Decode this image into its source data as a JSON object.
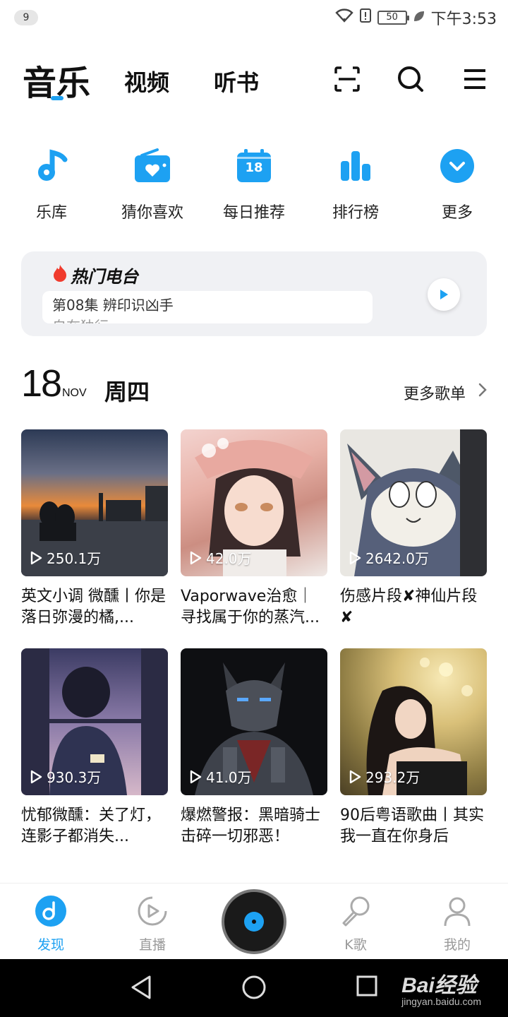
{
  "status_bar": {
    "notification_count": "9",
    "battery": "50",
    "time": "下午3:53"
  },
  "top_tabs": {
    "music": "音乐",
    "video": "视频",
    "audiobook": "听书"
  },
  "quick_actions": [
    {
      "label": "乐库",
      "icon": "music-note-icon"
    },
    {
      "label": "猜你喜欢",
      "icon": "radio-heart-icon"
    },
    {
      "label": "每日推荐",
      "icon": "calendar-icon",
      "day": "18"
    },
    {
      "label": "排行榜",
      "icon": "bar-chart-icon"
    },
    {
      "label": "更多",
      "icon": "chevron-down-icon"
    }
  ],
  "radio": {
    "title": "热门电台",
    "line1": "第08集 辨印识凶手",
    "line2": "自在独行"
  },
  "date": {
    "day": "18",
    "month": "NOV",
    "weekday": "周四",
    "more_label": "更多歌单"
  },
  "playlists": [
    {
      "count": "250.1万",
      "title": "英文小调  微醺丨你是落日弥漫的橘,..."
    },
    {
      "count": "42.0万",
      "title": "Vaporwave治愈｜寻找属于你的蒸汽..."
    },
    {
      "count": "2642.0万",
      "title": "伤感片段✘神仙片段✘"
    },
    {
      "count": "930.3万",
      "title": "忧郁微醺：关了灯，连影子都消失..."
    },
    {
      "count": "41.0万",
      "title": "爆燃警报：黑暗骑士 击碎一切邪恶！"
    },
    {
      "count": "293.2万",
      "title": "90后粤语歌曲丨其实我一直在你身后"
    }
  ],
  "bottom_nav": {
    "discover": "发现",
    "live": "直播",
    "karaoke": "K歌",
    "mine": "我的"
  },
  "watermark": {
    "brand": "Bai经验",
    "url": "jingyan.baidu.com"
  },
  "colors": {
    "accent": "#1da1f2"
  }
}
